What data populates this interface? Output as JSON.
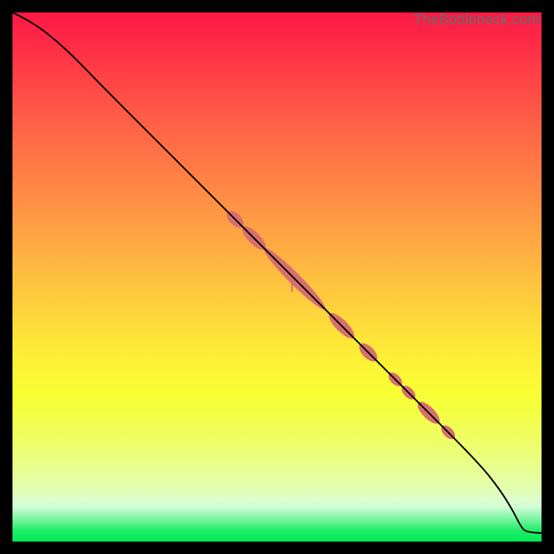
{
  "watermark": "TheBottleneck.com",
  "chart_data": {
    "type": "line",
    "title": "",
    "xlabel": "",
    "ylabel": "",
    "xlim": [
      0,
      100
    ],
    "ylim": [
      0,
      100
    ],
    "curve": [
      {
        "x": 0,
        "y": 100
      },
      {
        "x": 3,
        "y": 98.5
      },
      {
        "x": 6,
        "y": 96.5
      },
      {
        "x": 9,
        "y": 94
      },
      {
        "x": 12,
        "y": 91.2
      },
      {
        "x": 18,
        "y": 85
      },
      {
        "x": 30,
        "y": 73
      },
      {
        "x": 45,
        "y": 58
      },
      {
        "x": 60,
        "y": 43
      },
      {
        "x": 75,
        "y": 28
      },
      {
        "x": 88,
        "y": 15
      },
      {
        "x": 92,
        "y": 10
      },
      {
        "x": 94.5,
        "y": 6
      },
      {
        "x": 96,
        "y": 3
      },
      {
        "x": 97,
        "y": 1.8
      },
      {
        "x": 100,
        "y": 1.6
      }
    ],
    "highlight_clusters": [
      {
        "x_start": 41.0,
        "x_end": 43.2,
        "shape": "ellipse"
      },
      {
        "x_start": 43.8,
        "x_end": 47.5,
        "shape": "ellipse"
      },
      {
        "x_start": 47.8,
        "x_end": 58.8,
        "shape": "ellipse"
      },
      {
        "x_start": 60.2,
        "x_end": 64.2,
        "shape": "ellipse"
      },
      {
        "x_start": 66.0,
        "x_end": 68.5,
        "shape": "ellipse"
      },
      {
        "x_start": 71.5,
        "x_end": 73.2,
        "shape": "dot"
      },
      {
        "x_start": 74.0,
        "x_end": 75.7,
        "shape": "dot"
      },
      {
        "x_start": 77.0,
        "x_end": 80.3,
        "shape": "ellipse"
      },
      {
        "x_start": 81.5,
        "x_end": 83.2,
        "shape": "dot"
      }
    ],
    "highlight_color": "#d76f6d",
    "line_color": "#000000",
    "drip": {
      "x": 52.8,
      "len": 2.2
    }
  }
}
